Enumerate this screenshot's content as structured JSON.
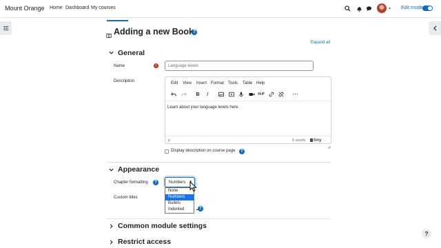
{
  "navbar": {
    "brand": "Mount Orange",
    "links": [
      "Home",
      "Dashboard",
      "My courses"
    ],
    "edit_mode_label": "Edit mode",
    "edit_mode_on": true,
    "icons": [
      "search-icon",
      "bell-icon",
      "chat-icon",
      "user-avatar",
      "chevron-down-icon"
    ]
  },
  "page": {
    "title": "Adding a new Book",
    "expand_all": "Expand all"
  },
  "sections": {
    "general": {
      "title": "General",
      "name_label": "Name",
      "name_placeholder": "Language levels",
      "description_label": "Description",
      "editor_menu": [
        "Edit",
        "View",
        "Insert",
        "Format",
        "Tools",
        "Table",
        "Help"
      ],
      "editor_text": "Learn about  your language levels here.",
      "status_path": "p",
      "word_count": "6 words",
      "tiny_brand": "tiny",
      "display_description_label": "Display description on course page"
    },
    "appearance": {
      "title": "Appearance",
      "chapter_formatting_label": "Chapter formatting",
      "chapter_formatting_value": "Numbers",
      "options": [
        "None",
        "Numbers",
        "Bullets",
        "Indented"
      ],
      "highlighted_option": "Numbers",
      "custom_titles_label": "Custom titles"
    },
    "common_module": {
      "title": "Common module settings"
    },
    "restrict_access": {
      "title": "Restrict access"
    }
  },
  "colors": {
    "accent": "#0f6cbf",
    "required": "#ca3120",
    "selected_option": "#1a73e8"
  }
}
